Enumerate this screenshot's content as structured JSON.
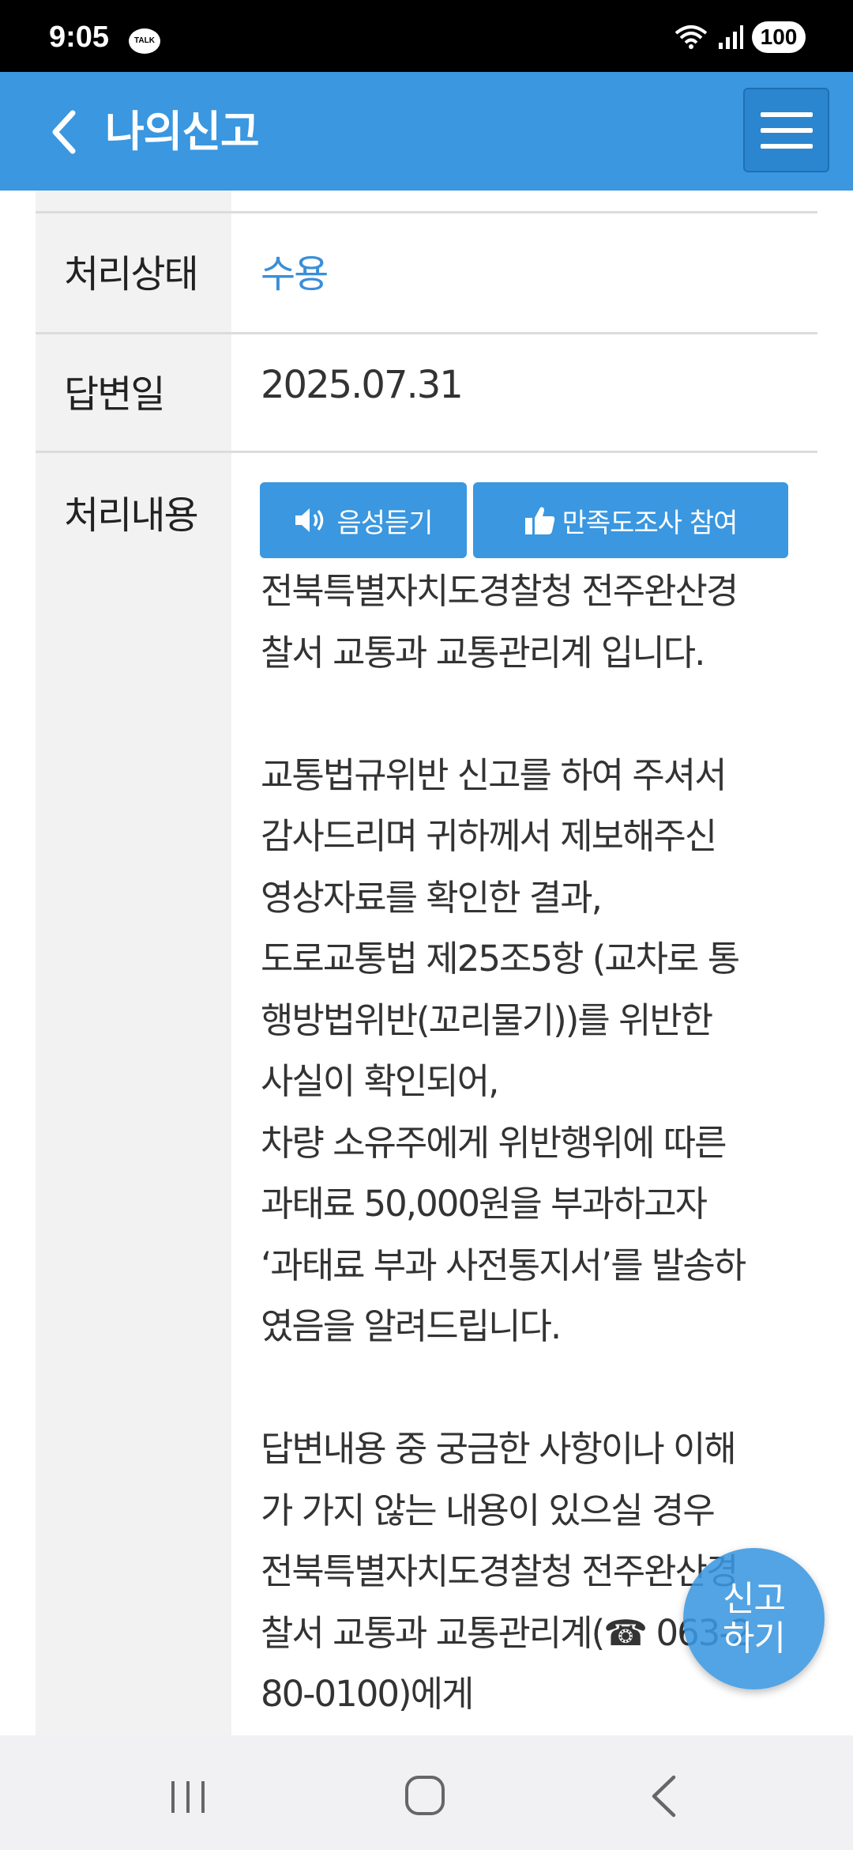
{
  "status_bar": {
    "time": "9:05",
    "talk_badge": "TALK",
    "battery": "100"
  },
  "header": {
    "title": "나의신고"
  },
  "details": {
    "status_label": "처리상태",
    "status_value": "수용",
    "answer_date_label": "답변일",
    "answer_date_value": "2025.07.31",
    "content_label": "처리내용",
    "voice_button": "음성듣기",
    "survey_button": "만족도조사 참여",
    "content_text": "전북특별자치도경찰청 전주완산경\n찰서 교통과 교통관리계 입니다.\n\n교통법규위반 신고를 하여 주셔서\n감사드리며 귀하께서 제보해주신\n영상자료를 확인한 결과,\n도로교통법 제25조5항 (교차로 통\n행방법위반(꼬리물기))를 위반한\n사실이 확인되어,\n차량 소유주에게 위반행위에 따른\n과태료 50,000원을 부과하고자\n‘과태료 부과 사전통지서’를 발송하\n였음을 알려드립니다.\n\n답변내용 중 궁금한 사항이나 이해\n가 가지 않는 내용이 있으실 경우\n전북특별자치도경찰청 전주완산경\n찰서 교통과 교통관리계(☎ 063-2\n80-0100)에게\n문의하시면 친절하게 답변해 드리"
  },
  "fab": {
    "line1": "신고",
    "line2": "하기"
  },
  "colors": {
    "primary": "#3a97e0",
    "status_accent": "#3a8fd8",
    "label_bg": "#f2f2f2"
  }
}
